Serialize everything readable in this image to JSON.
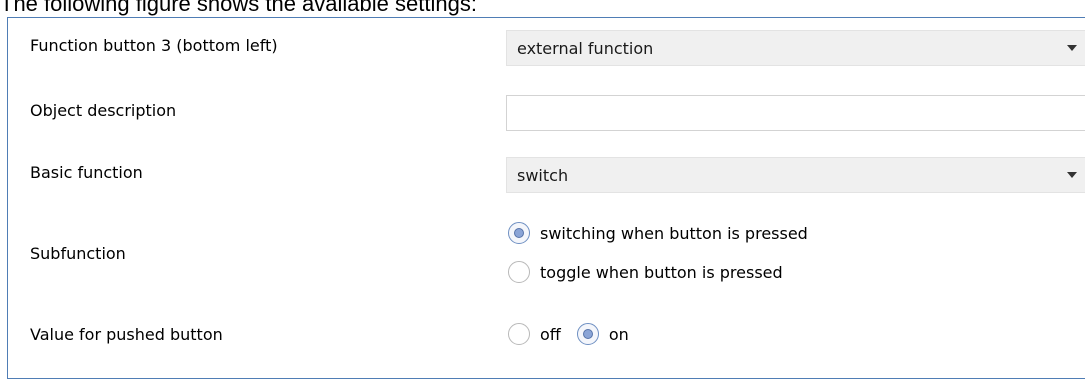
{
  "caption": "The following figure shows the available settings:",
  "rows": {
    "function_button": {
      "label": "Function button 3 (bottom left)",
      "selected": "external function"
    },
    "object_description": {
      "label": "Object description",
      "value": ""
    },
    "basic_function": {
      "label": "Basic function",
      "selected": "switch"
    },
    "subfunction": {
      "label": "Subfunction",
      "options": [
        {
          "label": "switching when button is pressed",
          "checked": true
        },
        {
          "label": "toggle when button is pressed",
          "checked": false
        }
      ]
    },
    "pushed_value": {
      "label": "Value for pushed button",
      "options": [
        {
          "label": "off",
          "checked": false
        },
        {
          "label": "on",
          "checked": true
        }
      ]
    }
  }
}
